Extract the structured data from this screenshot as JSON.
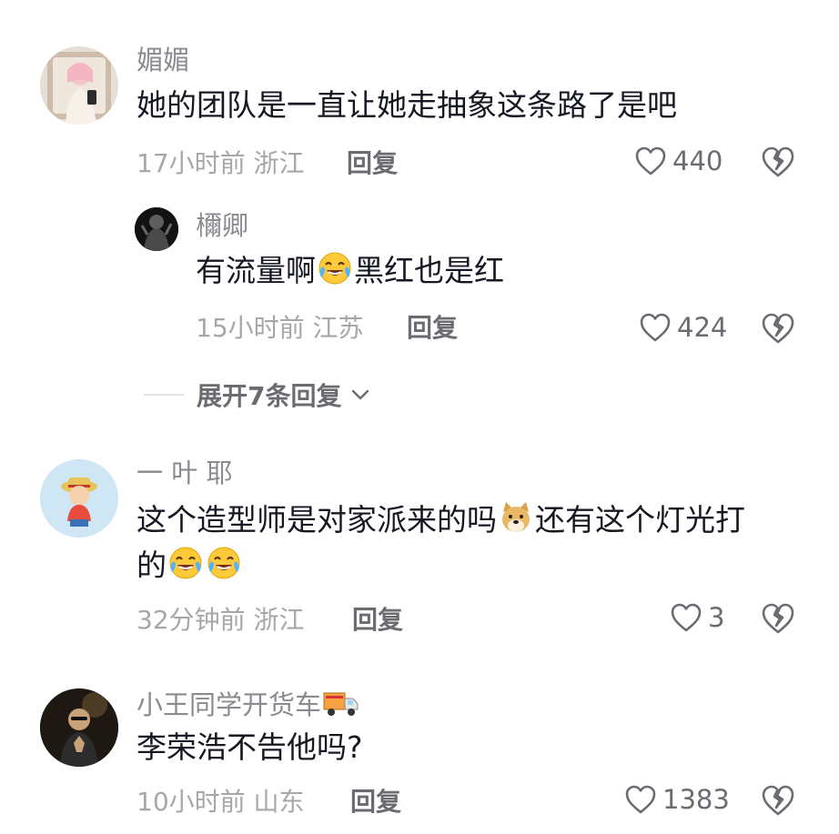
{
  "colors": {
    "text": "#161823",
    "username": "#8a8a90",
    "meta": "#a6a7ab",
    "action": "#6b6c72"
  },
  "comments": [
    {
      "username": "媚媚",
      "text": "她的团队是一直让她走抽象这条路了是吧",
      "time": "17小时前",
      "location": "浙江",
      "reply_label": "回复",
      "likes": "440",
      "replies": [
        {
          "username": "檷卿",
          "text_before": "有流量啊",
          "emoji": "crying-laughing",
          "text_after": "黑红也是红",
          "time": "15小时前",
          "location": "江苏",
          "reply_label": "回复",
          "likes": "424"
        }
      ],
      "expand_label": "展开7条回复"
    },
    {
      "username": "一 叶  耶",
      "text_line1": "这个造型师是对家派来的吗",
      "emoji1": "doge",
      "text_line1_after": "还有这个灯光打",
      "text_line2": "的",
      "emoji2": "crying-laughing",
      "time": "32分钟前",
      "location": "浙江",
      "reply_label": "回复",
      "likes": "3"
    },
    {
      "username": "小王同学开货车",
      "username_emoji": "delivery-truck",
      "text": "李荣浩不告他吗?",
      "time": "10小时前",
      "location": "山东",
      "reply_label": "回复",
      "likes": "1383"
    }
  ]
}
